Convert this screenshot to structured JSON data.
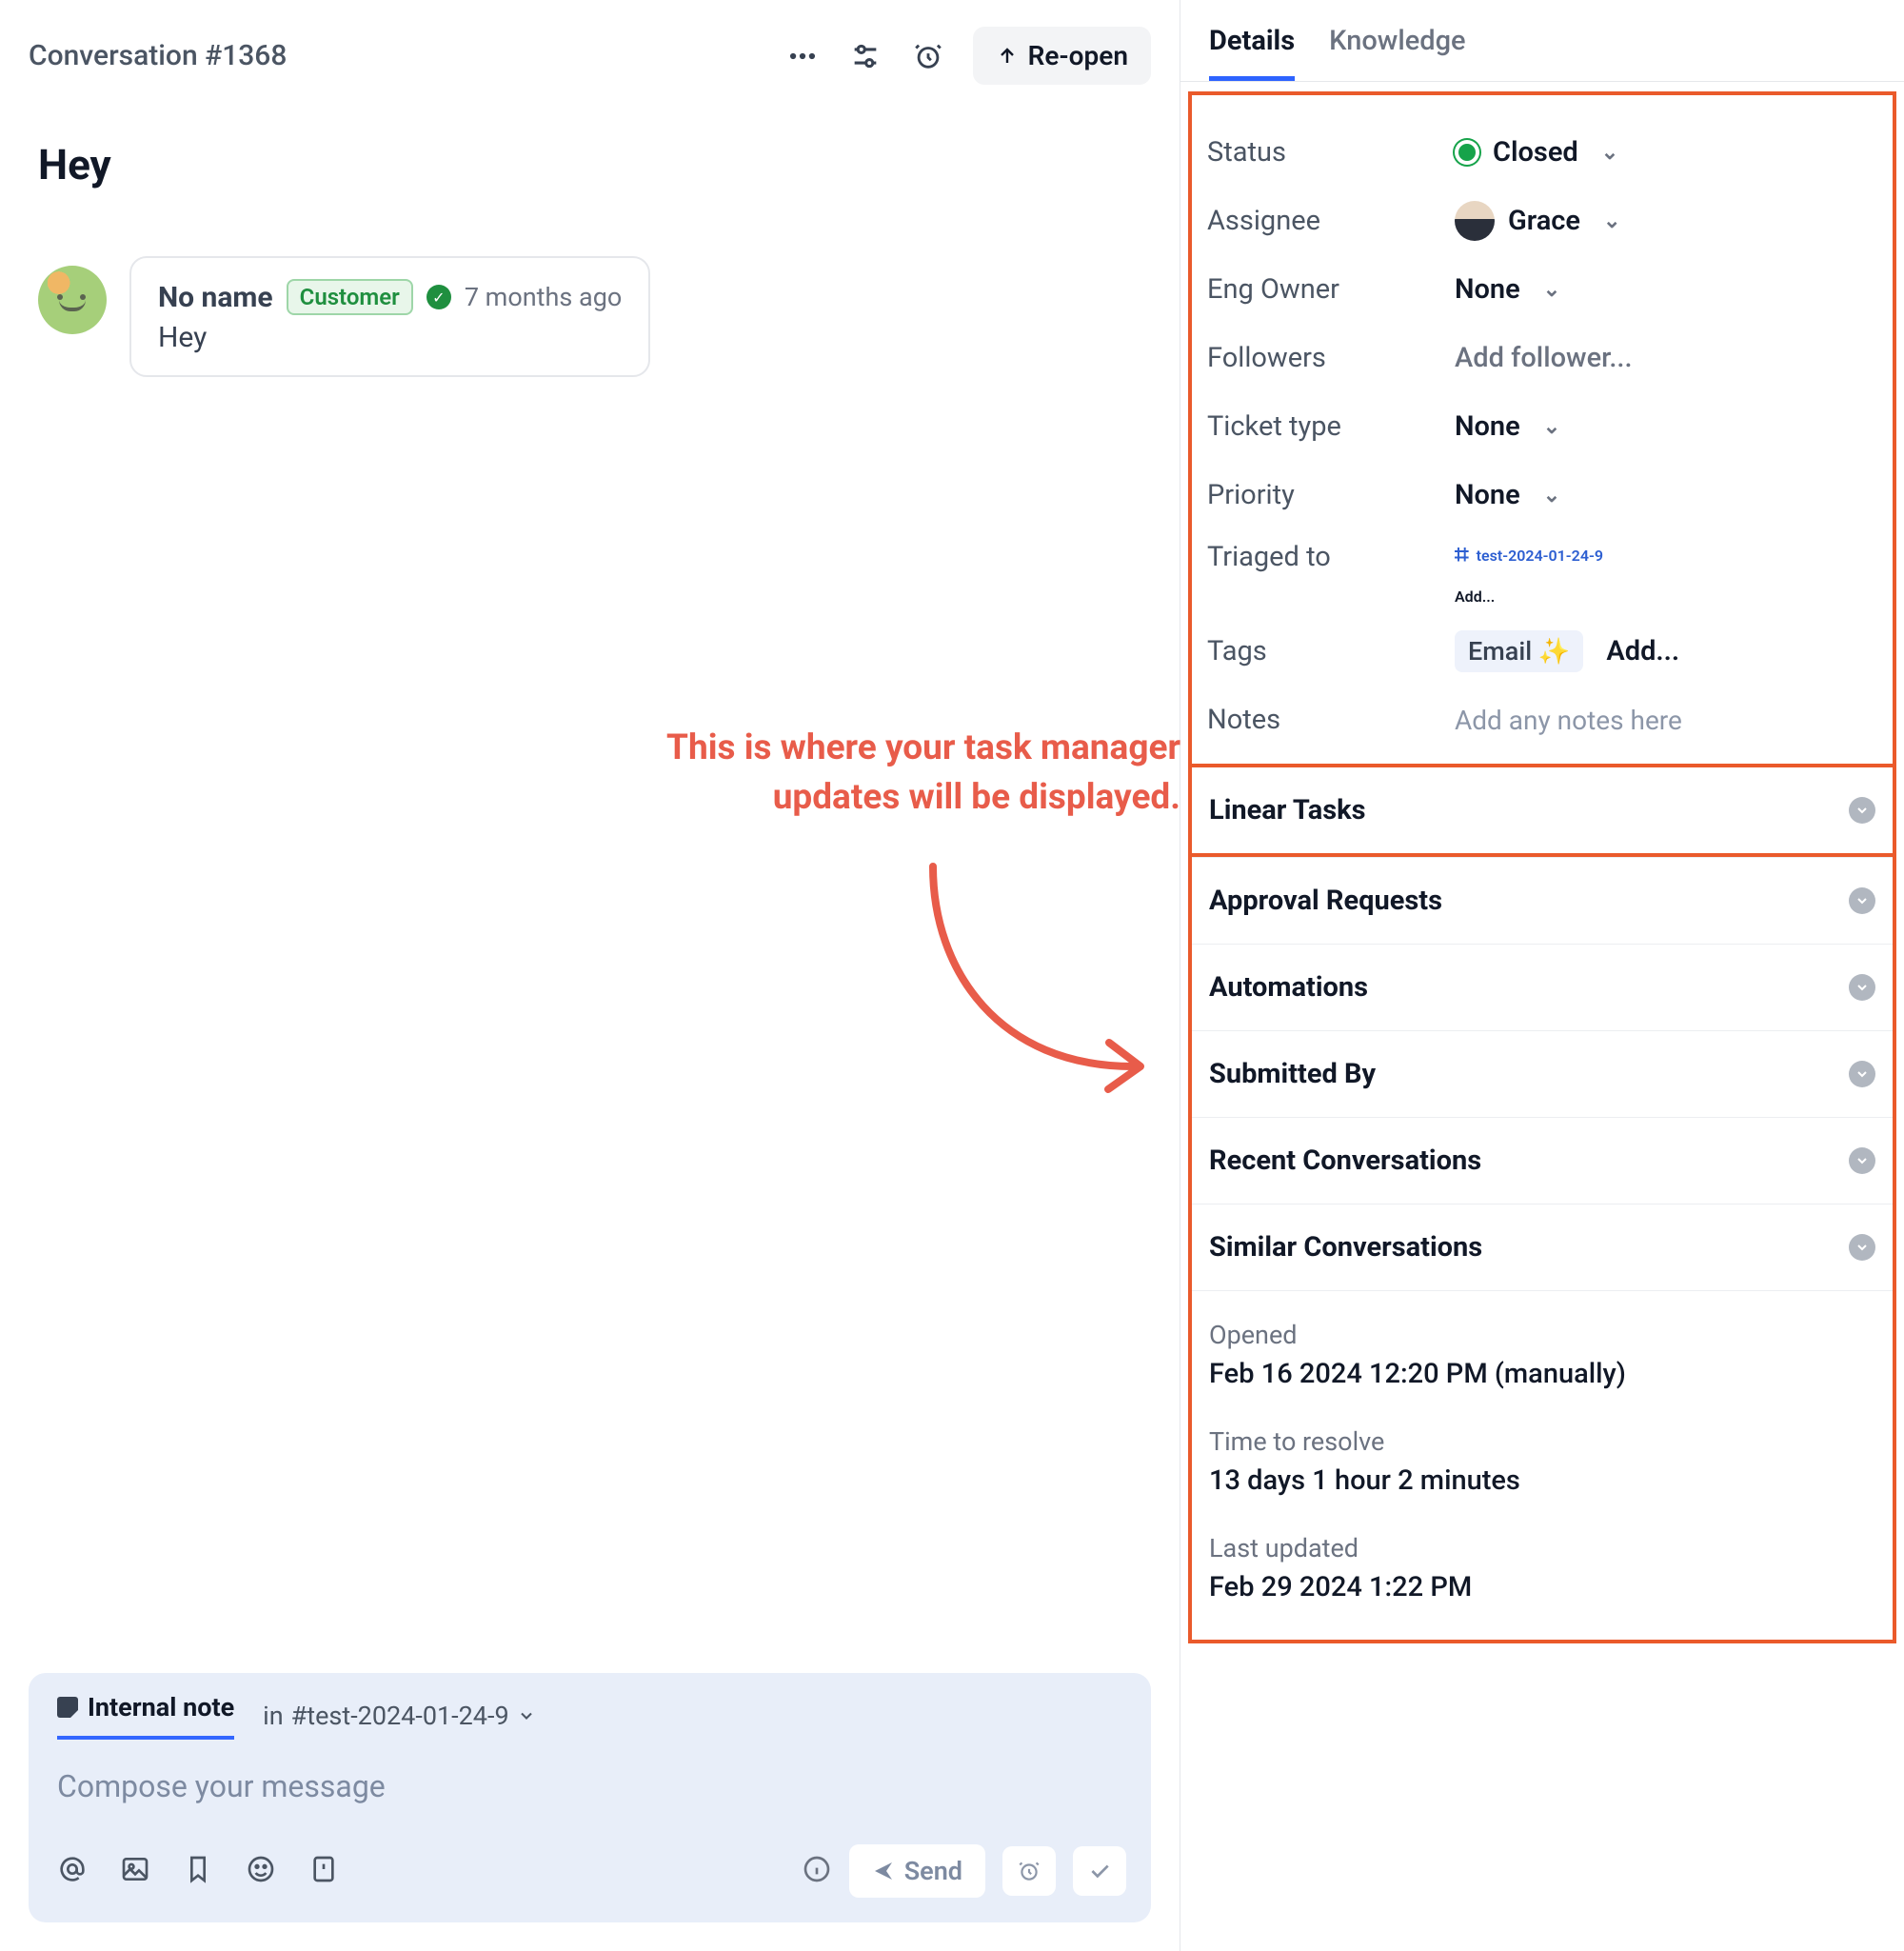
{
  "header": {
    "title": "Conversation #1368",
    "reopen_label": "Re-open"
  },
  "subject": "Hey",
  "message": {
    "sender": "No name",
    "badge": "Customer",
    "timestamp": "7 months ago",
    "body": "Hey"
  },
  "annotation": {
    "line1": "This is where your task manager",
    "line2": "updates will be displayed."
  },
  "compose": {
    "tab_label": "Internal note",
    "channel_prefix": "in ",
    "channel": "#test-2024-01-24-9",
    "placeholder": "Compose your message",
    "send_label": "Send"
  },
  "sidebar": {
    "tabs": {
      "details": "Details",
      "knowledge": "Knowledge"
    },
    "fields": {
      "status_label": "Status",
      "status_value": "Closed",
      "assignee_label": "Assignee",
      "assignee_value": "Grace",
      "eng_label": "Eng Owner",
      "eng_value": "None",
      "followers_label": "Followers",
      "followers_value": "Add follower...",
      "ticket_label": "Ticket type",
      "ticket_value": "None",
      "priority_label": "Priority",
      "priority_value": "None",
      "triaged_label": "Triaged to",
      "triaged_value": "test-2024-01-24-9",
      "triaged_add": "Add...",
      "tags_label": "Tags",
      "tags_value": "Email ✨",
      "tags_add": "Add...",
      "notes_label": "Notes",
      "notes_placeholder": "Add any notes here"
    },
    "sections": {
      "linear": "Linear Tasks",
      "approval": "Approval Requests",
      "automations": "Automations",
      "submitted": "Submitted By",
      "recent": "Recent Conversations",
      "similar": "Similar Conversations"
    },
    "meta": {
      "opened_label": "Opened",
      "opened_value": "Feb 16 2024 12:20 PM (manually)",
      "resolve_label": "Time to resolve",
      "resolve_value": "13 days 1 hour 2 minutes",
      "updated_label": "Last updated",
      "updated_value": "Feb 29 2024 1:22 PM"
    }
  }
}
